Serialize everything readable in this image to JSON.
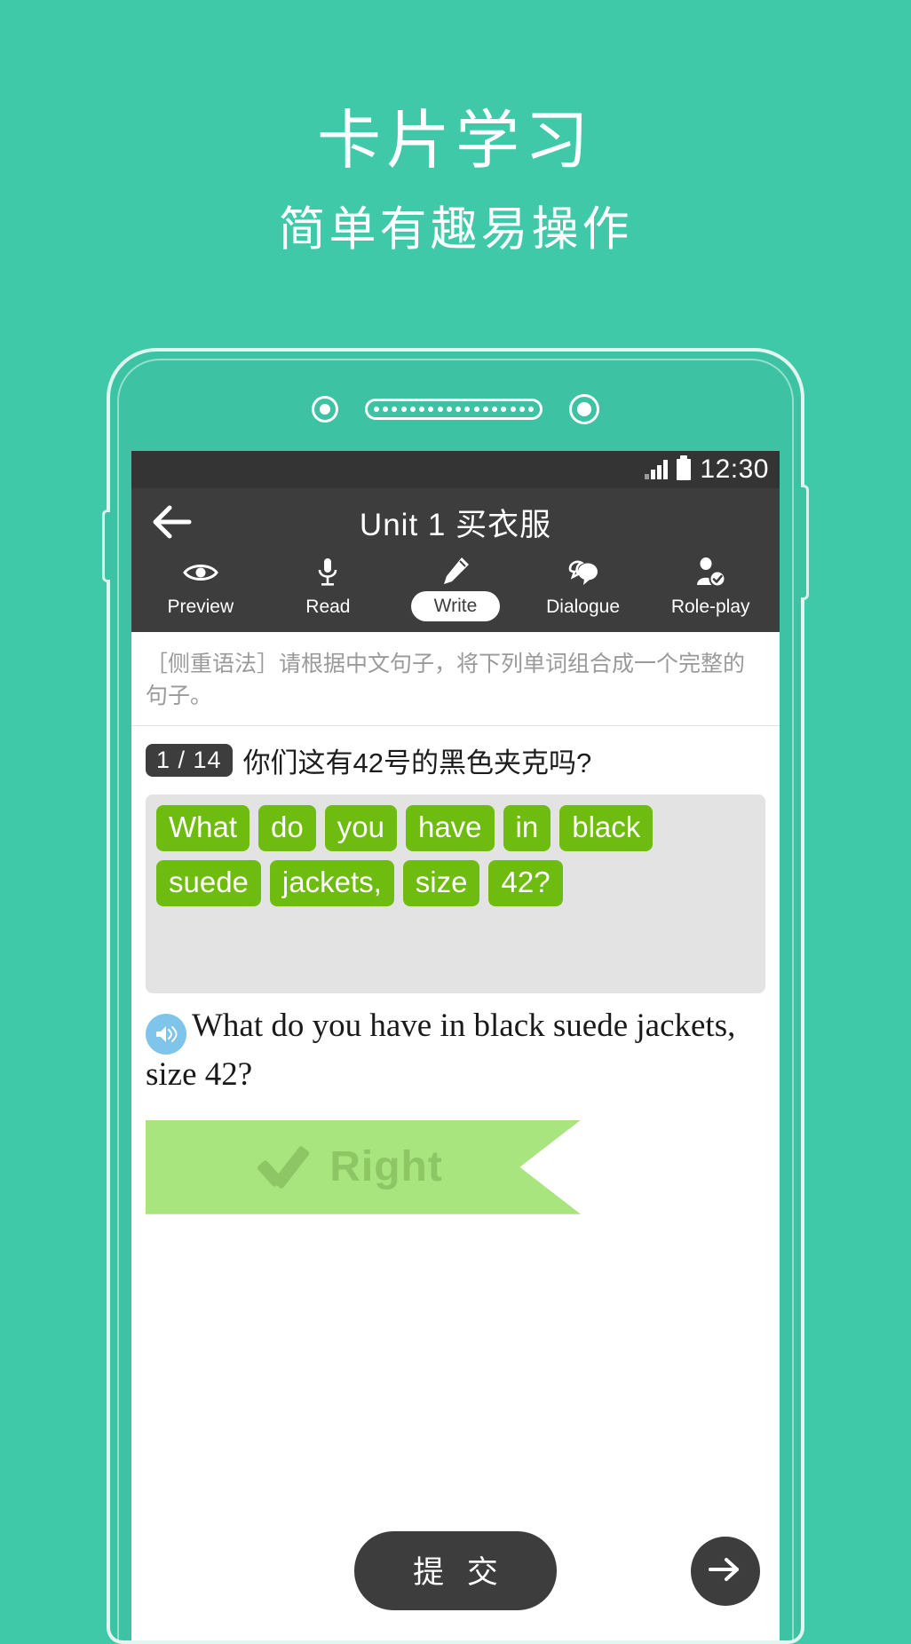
{
  "promo": {
    "title": "卡片学习",
    "subtitle": "简单有趣易操作"
  },
  "phone": {
    "camera_icon": "camera-dot",
    "speaker_icon": "speaker-grille",
    "sensor_icon": "sensor-dot"
  },
  "statusbar": {
    "signal_icon": "signal-bars-icon",
    "battery_icon": "battery-icon",
    "time": "12:30"
  },
  "appbar": {
    "back_icon": "back-arrow-icon",
    "title": "Unit 1 买衣服"
  },
  "tabs": [
    {
      "label": "Preview",
      "icon": "eye-icon",
      "active": false
    },
    {
      "label": "Read",
      "icon": "microphone-icon",
      "active": false
    },
    {
      "label": "Write",
      "icon": "pencil-icon",
      "active": true
    },
    {
      "label": "Dialogue",
      "icon": "speech-bubbles-icon",
      "active": false
    },
    {
      "label": "Role-play",
      "icon": "person-check-icon",
      "active": false
    }
  ],
  "exercise": {
    "instruction": "［侧重语法］请根据中文句子，将下列单词组合成一个完整的句子。",
    "progress_badge": "1 / 14",
    "prompt_cn": "你们这有42号的黑色夹克吗?",
    "word_tiles": [
      "What",
      "do",
      "you",
      "have",
      "in",
      "black",
      "suede",
      "jackets,",
      "size",
      "42?"
    ],
    "answer_sentence": "What do you have in black suede jackets, size 42?",
    "speaker_icon": "speaker-sound-icon",
    "result": {
      "label": "Right",
      "check_icon": "checkmark-icon"
    }
  },
  "footer": {
    "submit_label": "提 交",
    "next_icon": "arrow-right-icon"
  },
  "colors": {
    "background": "#3fc9a8",
    "tile_green": "#6fbc11",
    "ribbon_green": "#a8e57f",
    "ribbon_text": "#8cc665",
    "dark": "#3d3d3d",
    "speaker_blue": "#7fc4ea"
  }
}
